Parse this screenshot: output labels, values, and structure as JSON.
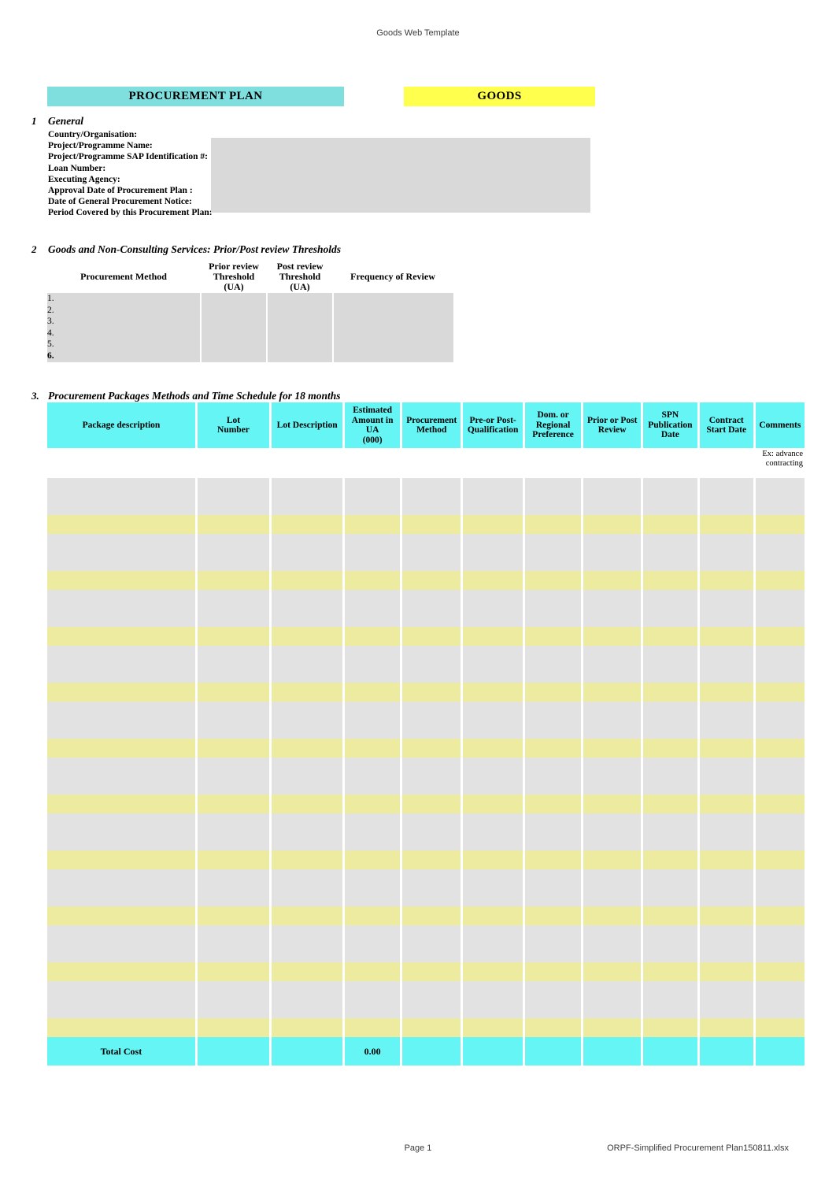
{
  "page": {
    "header_text": "Goods Web Template",
    "footer_page": "Page 1",
    "footer_file": "ORPF-Simplified Procurement Plan150811.xlsx"
  },
  "banners": {
    "plan": "PROCUREMENT PLAN",
    "goods": "GOODS",
    "plan_color": "#7fdede",
    "goods_color": "#ffff4d"
  },
  "section1": {
    "number": "1",
    "title": "General",
    "labels": [
      "Country/Organisation:",
      "Project/Programme Name:",
      "Project/Programme SAP Identification #:",
      "Loan Number:",
      "Executing Agency:",
      "Approval Date of Procurement Plan :",
      "Date of General Procurement Notice:",
      "Period Covered by this Procurement Plan:"
    ],
    "values": [
      "",
      "",
      "",
      "",
      "",
      "",
      "",
      ""
    ]
  },
  "section2": {
    "number": "2",
    "title": "Goods and Non-Consulting Services: Prior/Post review Thresholds",
    "columns": [
      "Procurement Method",
      "Prior review Threshold (UA)",
      "Post review Threshold (UA)",
      "Frequency of Review"
    ],
    "column_lines": {
      "c0": "Procurement Method",
      "c1a": "Prior review",
      "c1b": "Threshold",
      "c1c": "(UA)",
      "c2a": "Post review",
      "c2b": "Threshold",
      "c2c": "(UA)",
      "c3": "Frequency of Review"
    },
    "row_numbers": [
      "1.",
      "2.",
      "3.",
      "4.",
      "5.",
      "6."
    ],
    "rows": [
      {
        "method": "",
        "prior": "",
        "post": "",
        "frequency": ""
      },
      {
        "method": "",
        "prior": "",
        "post": "",
        "frequency": ""
      },
      {
        "method": "",
        "prior": "",
        "post": "",
        "frequency": ""
      },
      {
        "method": "",
        "prior": "",
        "post": "",
        "frequency": ""
      },
      {
        "method": "",
        "prior": "",
        "post": "",
        "frequency": ""
      },
      {
        "method": "",
        "prior": "",
        "post": "",
        "frequency": ""
      }
    ]
  },
  "section3": {
    "number": "3.",
    "title": "Procurement Packages Methods and Time Schedule for 18 months",
    "header_color": "#66f5f5",
    "row_gray_color": "#e2e2e2",
    "row_yellow_color": "#edeb9f",
    "columns": [
      {
        "key": "package",
        "label": "Package description"
      },
      {
        "key": "lot_number",
        "label_1": "Lot",
        "label_2": "Number"
      },
      {
        "key": "lot_description",
        "label": "Lot Description"
      },
      {
        "key": "estimated_amount",
        "label_1": "Estimated",
        "label_2": "Amount in UA",
        "label_3": "(000)"
      },
      {
        "key": "procurement_method",
        "label_1": "Procurement",
        "label_2": "Method"
      },
      {
        "key": "pre_post_qualification",
        "label_1": "Pre-or Post-",
        "label_2": "Qualification"
      },
      {
        "key": "dom_regional_preference",
        "label_1": "Dom. or",
        "label_2": "Regional",
        "label_3": "Preference"
      },
      {
        "key": "prior_post_review",
        "label_1": "Prior or Post",
        "label_2": "Review"
      },
      {
        "key": "spn_publication_date",
        "label_1": "SPN",
        "label_2": "Publication",
        "label_3": "Date"
      },
      {
        "key": "contract_start_date",
        "label_1": "Contract",
        "label_2": "Start Date"
      },
      {
        "key": "comments",
        "label": "Comments"
      }
    ],
    "example_row": {
      "comments_1": "Ex: advance",
      "comments_2": "contracting"
    },
    "total": {
      "label": "Total Cost",
      "amount": "0.00"
    },
    "data_rows": 20
  }
}
